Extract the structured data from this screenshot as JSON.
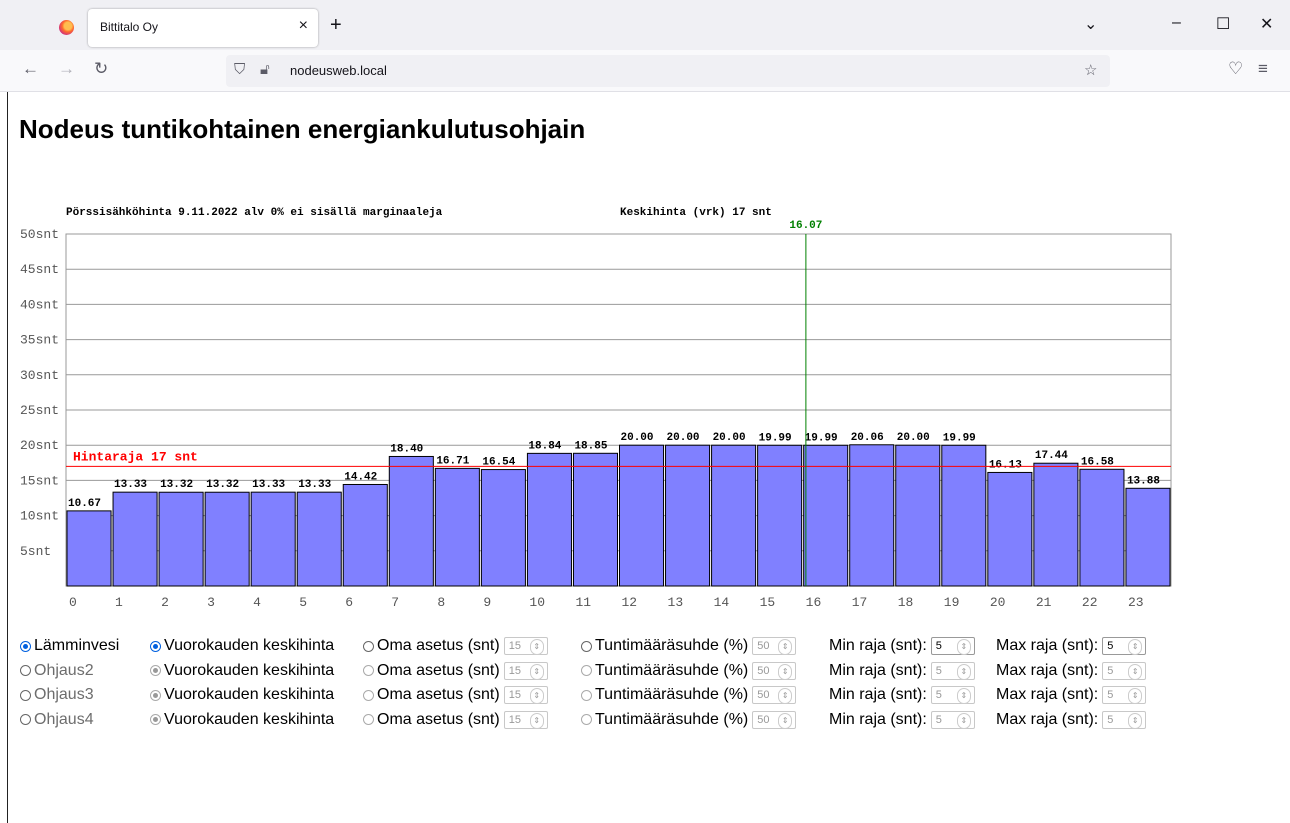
{
  "browser": {
    "tab_title": "Bittitalo Oy",
    "tab_close": "×",
    "new_tab": "+",
    "url": "nodeusweb.local",
    "controls": {
      "dropdown": "⌄",
      "minimize": "–",
      "maximize": "☐",
      "close": "✕"
    }
  },
  "page": {
    "title": "Nodeus tuntikohtainen energiankulutusohjain"
  },
  "chart_data": {
    "type": "bar",
    "title": "Pörssisähköhinta 9.11.2022 alv 0% ei sisällä marginaaleja",
    "subtitle": "Keskihinta (vrk) 17 snt",
    "categories": [
      "0",
      "1",
      "2",
      "3",
      "4",
      "5",
      "6",
      "7",
      "8",
      "9",
      "10",
      "11",
      "12",
      "13",
      "14",
      "15",
      "16",
      "17",
      "18",
      "19",
      "20",
      "21",
      "22",
      "23"
    ],
    "values": [
      10.67,
      13.33,
      13.32,
      13.32,
      13.33,
      13.33,
      14.42,
      18.4,
      16.71,
      16.54,
      18.84,
      18.85,
      20.0,
      20.0,
      20.0,
      19.99,
      19.99,
      20.06,
      20.0,
      19.99,
      16.13,
      17.44,
      16.58,
      13.88
    ],
    "y_ticks": [
      "5snt",
      "10snt",
      "15snt",
      "20snt",
      "25snt",
      "30snt",
      "35snt",
      "40snt",
      "45snt",
      "50snt"
    ],
    "ylim": [
      0,
      50
    ],
    "threshold": {
      "value": 17,
      "label": "Hintaraja 17 snt",
      "color": "#ff0000"
    },
    "current_time": {
      "x": 16.07,
      "label": "16.07",
      "color": "#008000"
    },
    "bar_color": "#8080ff",
    "grid": true
  },
  "controls": {
    "rows": [
      {
        "name": "Lämminvesi",
        "selected": true,
        "enabled": true,
        "mode1": "Vuorokauden keskihinta",
        "mode2": "Oma asetus (snt)",
        "own_value": "15",
        "mode3": "Tuntimääräsuhde (%)",
        "ratio_value": "50",
        "min_label": "Min raja (snt):",
        "min_value": "5",
        "max_label": "Max raja (snt):",
        "max_value": "5"
      },
      {
        "name": "Ohjaus2",
        "selected": false,
        "enabled": false,
        "mode1": "Vuorokauden keskihinta",
        "mode2": "Oma asetus (snt)",
        "own_value": "15",
        "mode3": "Tuntimääräsuhde (%)",
        "ratio_value": "50",
        "min_label": "Min raja (snt):",
        "min_value": "5",
        "max_label": "Max raja (snt):",
        "max_value": "5"
      },
      {
        "name": "Ohjaus3",
        "selected": false,
        "enabled": false,
        "mode1": "Vuorokauden keskihinta",
        "mode2": "Oma asetus (snt)",
        "own_value": "15",
        "mode3": "Tuntimääräsuhde (%)",
        "ratio_value": "50",
        "min_label": "Min raja (snt):",
        "min_value": "5",
        "max_label": "Max raja (snt):",
        "max_value": "5"
      },
      {
        "name": "Ohjaus4",
        "selected": false,
        "enabled": false,
        "mode1": "Vuorokauden keskihinta",
        "mode2": "Oma asetus (snt)",
        "own_value": "15",
        "mode3": "Tuntimääräsuhde (%)",
        "ratio_value": "50",
        "min_label": "Min raja (snt):",
        "min_value": "5",
        "max_label": "Max raja (snt):",
        "max_value": "5"
      }
    ]
  }
}
